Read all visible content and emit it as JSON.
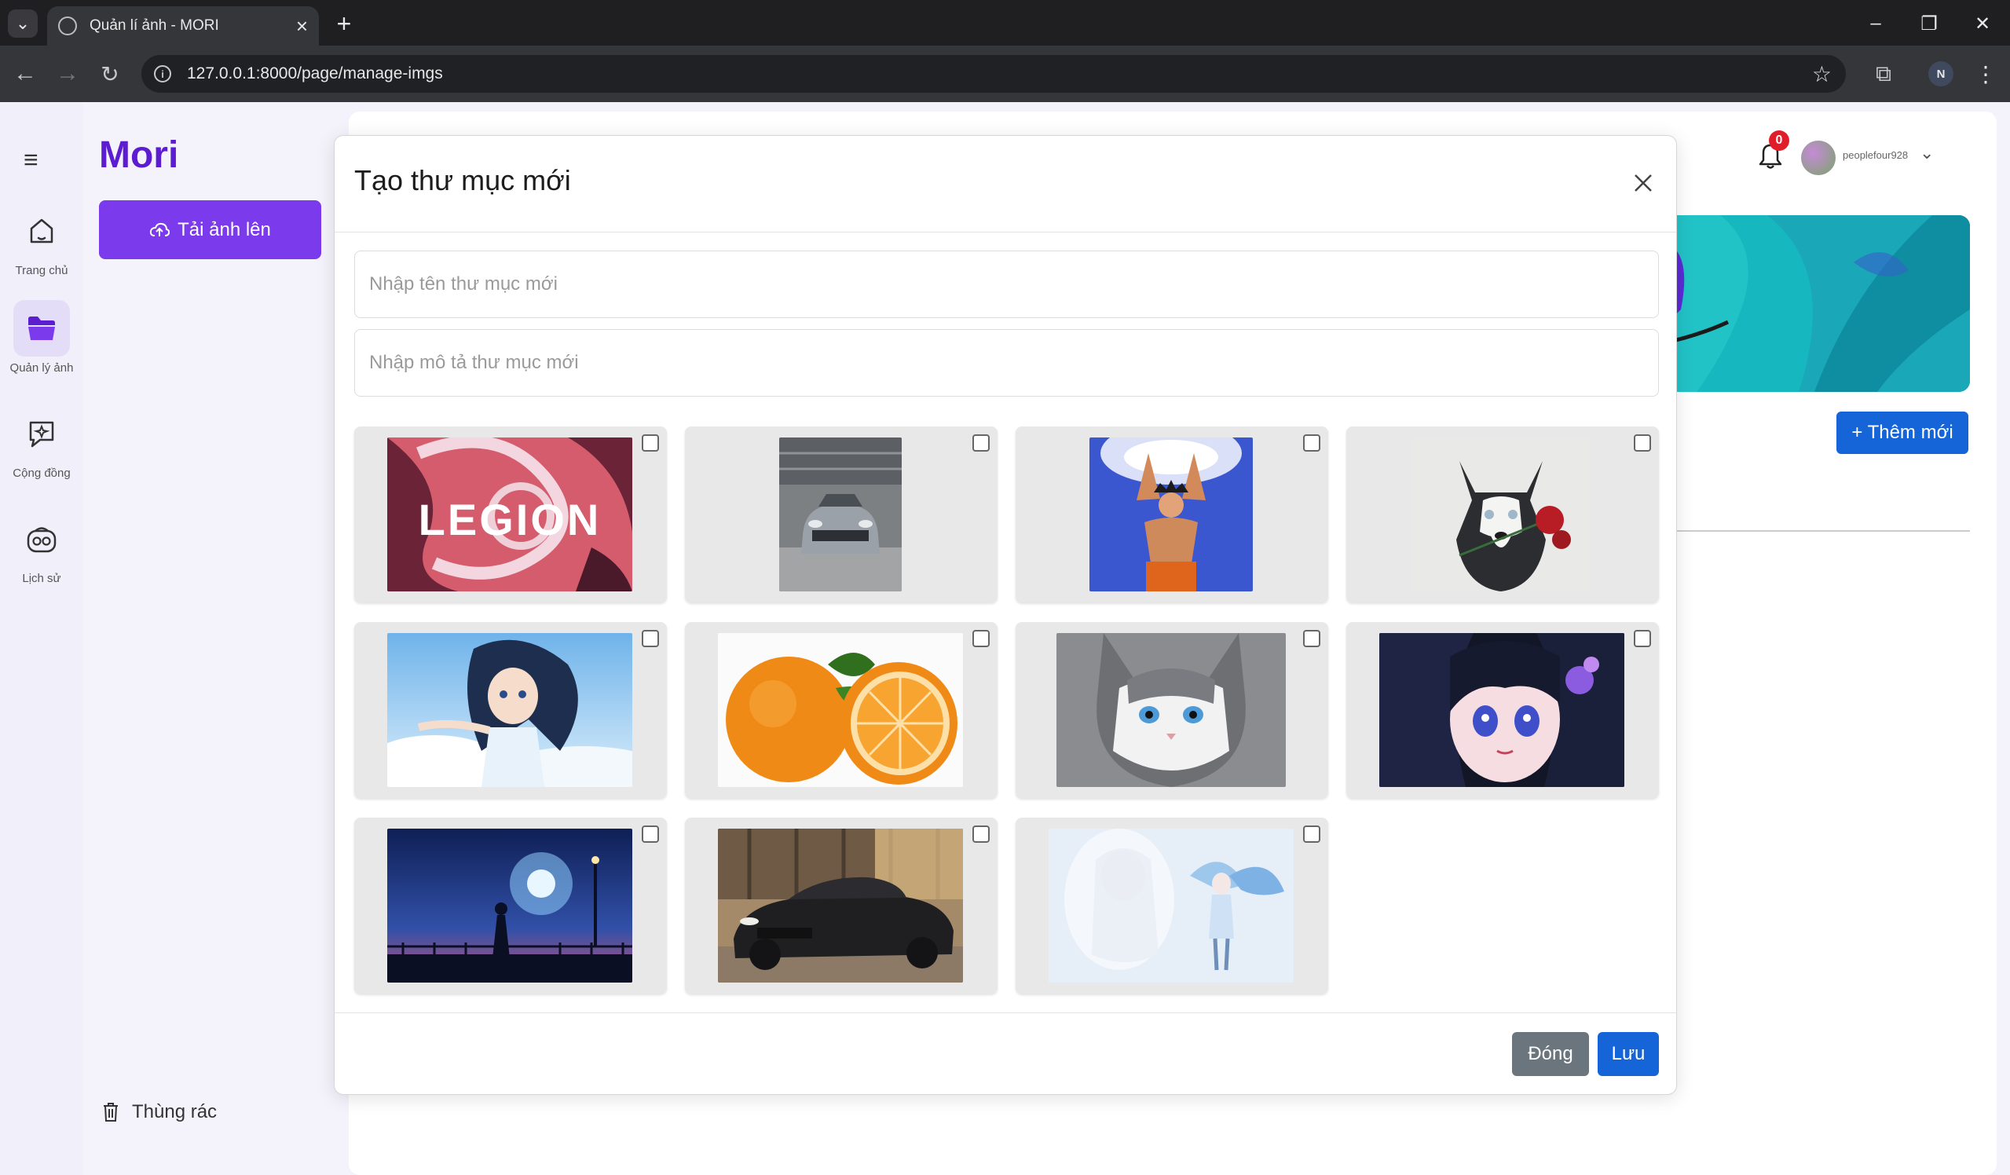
{
  "browser": {
    "tab_title": "Quản lí ảnh - MORI",
    "url": "127.0.0.1:8000/page/manage-imgs",
    "profile_initial": "N"
  },
  "rail": {
    "items": [
      {
        "label": "Trang chủ",
        "icon": "home-icon"
      },
      {
        "label": "Quản lý ảnh",
        "icon": "folder-icon"
      },
      {
        "label": "Cộng đồng",
        "icon": "community-icon"
      },
      {
        "label": "Lịch sử",
        "icon": "history-icon"
      }
    ]
  },
  "sidebar": {
    "logo": "Mori",
    "upload_label": "Tải ảnh lên",
    "trash_label": "Thùng rác"
  },
  "header": {
    "notification_count": "0",
    "username": "peoplefour928"
  },
  "main": {
    "add_new_label": "+ Thêm mới"
  },
  "modal": {
    "title": "Tạo thư mục mới",
    "name_placeholder": "Nhập tên thư mục mới",
    "desc_placeholder": "Nhập mô tả thư mục mới",
    "images": [
      {
        "label": "Legion",
        "checked": false
      },
      {
        "label": "grey car",
        "checked": false
      },
      {
        "label": "goku",
        "checked": false
      },
      {
        "label": "husky",
        "checked": false
      },
      {
        "label": "anime girl sky",
        "checked": false
      },
      {
        "label": "orange",
        "checked": false
      },
      {
        "label": "cat",
        "checked": false
      },
      {
        "label": "anime girl purple",
        "checked": false
      },
      {
        "label": "night scene",
        "checked": false
      },
      {
        "label": "black car",
        "checked": false
      },
      {
        "label": "angel",
        "checked": false
      }
    ],
    "close_label": "Đóng",
    "save_label": "Lưu"
  },
  "colors": {
    "brand": "#5b1dcf",
    "upload_button": "#7c3aed",
    "primary_button": "#1565d8",
    "secondary_button": "#6b757e"
  }
}
